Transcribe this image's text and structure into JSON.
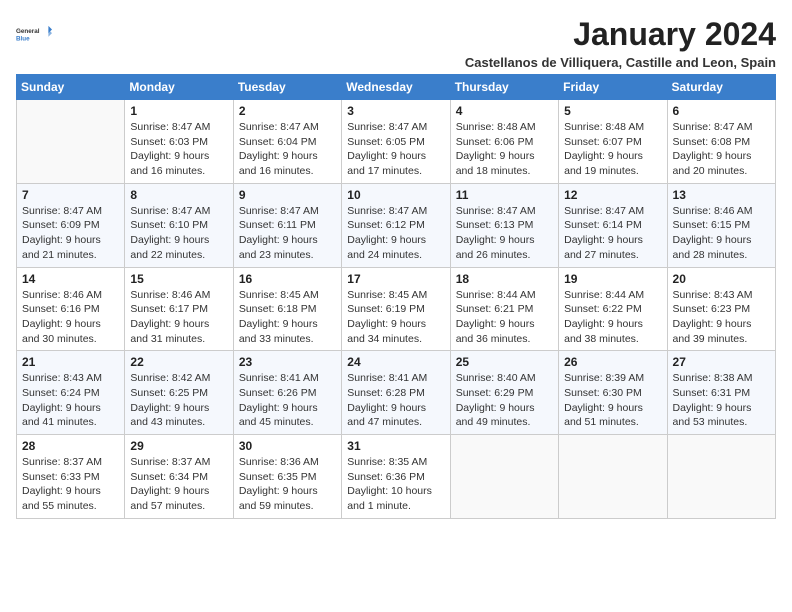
{
  "logo": {
    "general": "General",
    "blue": "Blue"
  },
  "header": {
    "title": "January 2024",
    "subtitle": "Castellanos de Villiquera, Castille and Leon, Spain"
  },
  "weekdays": [
    "Sunday",
    "Monday",
    "Tuesday",
    "Wednesday",
    "Thursday",
    "Friday",
    "Saturday"
  ],
  "weeks": [
    [
      {
        "day": "",
        "info": ""
      },
      {
        "day": "1",
        "info": "Sunrise: 8:47 AM\nSunset: 6:03 PM\nDaylight: 9 hours\nand 16 minutes."
      },
      {
        "day": "2",
        "info": "Sunrise: 8:47 AM\nSunset: 6:04 PM\nDaylight: 9 hours\nand 16 minutes."
      },
      {
        "day": "3",
        "info": "Sunrise: 8:47 AM\nSunset: 6:05 PM\nDaylight: 9 hours\nand 17 minutes."
      },
      {
        "day": "4",
        "info": "Sunrise: 8:48 AM\nSunset: 6:06 PM\nDaylight: 9 hours\nand 18 minutes."
      },
      {
        "day": "5",
        "info": "Sunrise: 8:48 AM\nSunset: 6:07 PM\nDaylight: 9 hours\nand 19 minutes."
      },
      {
        "day": "6",
        "info": "Sunrise: 8:47 AM\nSunset: 6:08 PM\nDaylight: 9 hours\nand 20 minutes."
      }
    ],
    [
      {
        "day": "7",
        "info": "Sunrise: 8:47 AM\nSunset: 6:09 PM\nDaylight: 9 hours\nand 21 minutes."
      },
      {
        "day": "8",
        "info": "Sunrise: 8:47 AM\nSunset: 6:10 PM\nDaylight: 9 hours\nand 22 minutes."
      },
      {
        "day": "9",
        "info": "Sunrise: 8:47 AM\nSunset: 6:11 PM\nDaylight: 9 hours\nand 23 minutes."
      },
      {
        "day": "10",
        "info": "Sunrise: 8:47 AM\nSunset: 6:12 PM\nDaylight: 9 hours\nand 24 minutes."
      },
      {
        "day": "11",
        "info": "Sunrise: 8:47 AM\nSunset: 6:13 PM\nDaylight: 9 hours\nand 26 minutes."
      },
      {
        "day": "12",
        "info": "Sunrise: 8:47 AM\nSunset: 6:14 PM\nDaylight: 9 hours\nand 27 minutes."
      },
      {
        "day": "13",
        "info": "Sunrise: 8:46 AM\nSunset: 6:15 PM\nDaylight: 9 hours\nand 28 minutes."
      }
    ],
    [
      {
        "day": "14",
        "info": "Sunrise: 8:46 AM\nSunset: 6:16 PM\nDaylight: 9 hours\nand 30 minutes."
      },
      {
        "day": "15",
        "info": "Sunrise: 8:46 AM\nSunset: 6:17 PM\nDaylight: 9 hours\nand 31 minutes."
      },
      {
        "day": "16",
        "info": "Sunrise: 8:45 AM\nSunset: 6:18 PM\nDaylight: 9 hours\nand 33 minutes."
      },
      {
        "day": "17",
        "info": "Sunrise: 8:45 AM\nSunset: 6:19 PM\nDaylight: 9 hours\nand 34 minutes."
      },
      {
        "day": "18",
        "info": "Sunrise: 8:44 AM\nSunset: 6:21 PM\nDaylight: 9 hours\nand 36 minutes."
      },
      {
        "day": "19",
        "info": "Sunrise: 8:44 AM\nSunset: 6:22 PM\nDaylight: 9 hours\nand 38 minutes."
      },
      {
        "day": "20",
        "info": "Sunrise: 8:43 AM\nSunset: 6:23 PM\nDaylight: 9 hours\nand 39 minutes."
      }
    ],
    [
      {
        "day": "21",
        "info": "Sunrise: 8:43 AM\nSunset: 6:24 PM\nDaylight: 9 hours\nand 41 minutes."
      },
      {
        "day": "22",
        "info": "Sunrise: 8:42 AM\nSunset: 6:25 PM\nDaylight: 9 hours\nand 43 minutes."
      },
      {
        "day": "23",
        "info": "Sunrise: 8:41 AM\nSunset: 6:26 PM\nDaylight: 9 hours\nand 45 minutes."
      },
      {
        "day": "24",
        "info": "Sunrise: 8:41 AM\nSunset: 6:28 PM\nDaylight: 9 hours\nand 47 minutes."
      },
      {
        "day": "25",
        "info": "Sunrise: 8:40 AM\nSunset: 6:29 PM\nDaylight: 9 hours\nand 49 minutes."
      },
      {
        "day": "26",
        "info": "Sunrise: 8:39 AM\nSunset: 6:30 PM\nDaylight: 9 hours\nand 51 minutes."
      },
      {
        "day": "27",
        "info": "Sunrise: 8:38 AM\nSunset: 6:31 PM\nDaylight: 9 hours\nand 53 minutes."
      }
    ],
    [
      {
        "day": "28",
        "info": "Sunrise: 8:37 AM\nSunset: 6:33 PM\nDaylight: 9 hours\nand 55 minutes."
      },
      {
        "day": "29",
        "info": "Sunrise: 8:37 AM\nSunset: 6:34 PM\nDaylight: 9 hours\nand 57 minutes."
      },
      {
        "day": "30",
        "info": "Sunrise: 8:36 AM\nSunset: 6:35 PM\nDaylight: 9 hours\nand 59 minutes."
      },
      {
        "day": "31",
        "info": "Sunrise: 8:35 AM\nSunset: 6:36 PM\nDaylight: 10 hours\nand 1 minute."
      },
      {
        "day": "",
        "info": ""
      },
      {
        "day": "",
        "info": ""
      },
      {
        "day": "",
        "info": ""
      }
    ]
  ]
}
